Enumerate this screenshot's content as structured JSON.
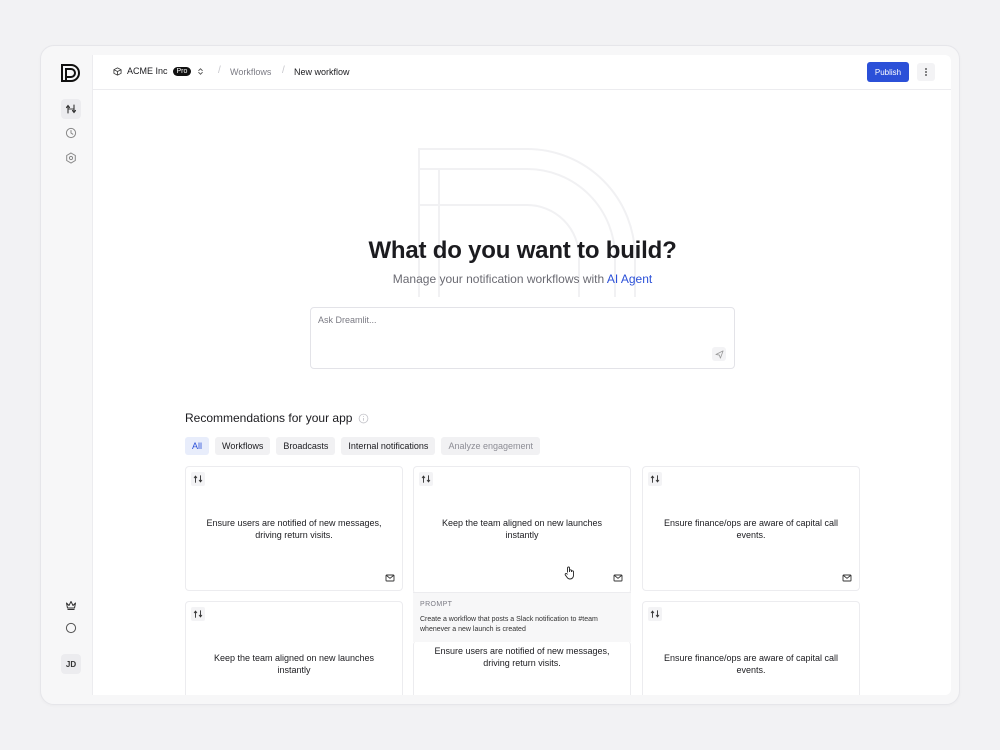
{
  "header": {
    "org_name": "ACME Inc",
    "plan_badge": "Pro",
    "breadcrumb": [
      "Workflows",
      "New workflow"
    ],
    "publish_label": "Publish"
  },
  "sidebar": {
    "items": [
      {
        "icon": "workflows-icon",
        "active": true
      },
      {
        "icon": "history-icon",
        "active": false
      },
      {
        "icon": "settings-icon",
        "active": false
      }
    ],
    "bottom": [
      {
        "icon": "crown-icon"
      },
      {
        "icon": "circle-icon"
      }
    ],
    "avatar_initials": "JD"
  },
  "hero": {
    "title": "What do you want to build?",
    "subtitle_prefix": "Manage your notification workflows with ",
    "subtitle_link": "AI Agent"
  },
  "prompt": {
    "placeholder": "Ask Dreamlit..."
  },
  "recommendations": {
    "title": "Recommendations for your app",
    "filters": [
      "All",
      "Workflows",
      "Broadcasts",
      "Internal notifications",
      "Analyze engagement"
    ],
    "active_filter": "All",
    "cards": [
      {
        "text": "Ensure users are notified of new messages, driving return visits."
      },
      {
        "text": "Keep the team aligned on new launches instantly"
      },
      {
        "text": "Ensure finance/ops are aware of capital call events."
      },
      {
        "text": "Keep the team aligned on new launches instantly"
      },
      {
        "text": "Ensure users are notified of new messages, driving return visits."
      },
      {
        "text": "Ensure finance/ops are aware of capital call events."
      }
    ],
    "hover_prompt": {
      "label": "PROMPT",
      "text": "Create a workflow that posts a Slack notification to #team whenever a new launch is created"
    }
  },
  "colors": {
    "accent": "#2b50d8",
    "background": "#f2f2f4",
    "surface": "#ffffff"
  }
}
